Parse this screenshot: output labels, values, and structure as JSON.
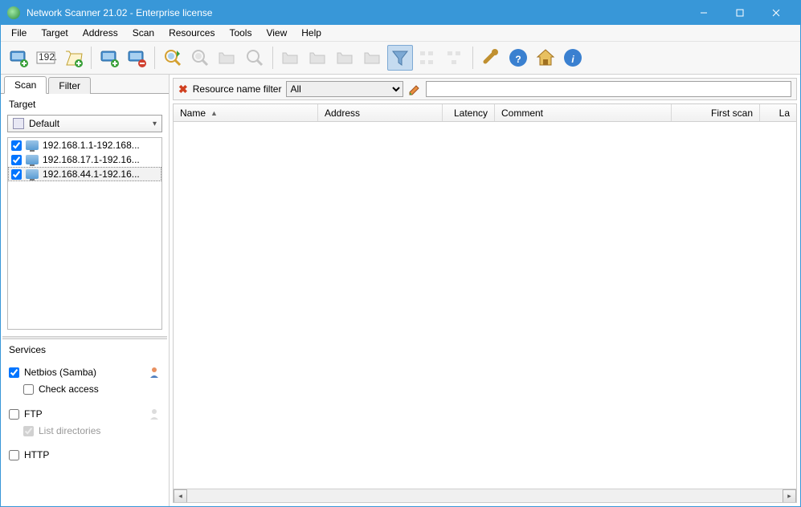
{
  "window": {
    "title": "Network Scanner 21.02 - Enterprise license"
  },
  "menu": {
    "items": [
      "File",
      "Target",
      "Address",
      "Scan",
      "Resources",
      "Tools",
      "View",
      "Help"
    ]
  },
  "sidebar": {
    "tabs": {
      "scan": "Scan",
      "filter": "Filter"
    },
    "target_label": "Target",
    "target_dropdown": "Default",
    "targets": [
      {
        "checked": true,
        "label": "192.168.1.1-192.168..."
      },
      {
        "checked": true,
        "label": "192.168.17.1-192.16..."
      },
      {
        "checked": true,
        "label": "192.168.44.1-192.16...",
        "selected": true
      }
    ],
    "services_label": "Services",
    "services": {
      "netbios": {
        "label": "Netbios (Samba)",
        "checked": true,
        "check_access": "Check access",
        "check_access_checked": false
      },
      "ftp": {
        "label": "FTP",
        "checked": false,
        "list_dirs": "List directories",
        "list_dirs_checked": true
      },
      "http": {
        "label": "HTTP",
        "checked": false
      }
    }
  },
  "filterbar": {
    "label": "Resource name filter",
    "selected": "All",
    "text": ""
  },
  "columns": {
    "name": "Name",
    "address": "Address",
    "latency": "Latency",
    "comment": "Comment",
    "first_scan": "First scan",
    "last": "La"
  }
}
